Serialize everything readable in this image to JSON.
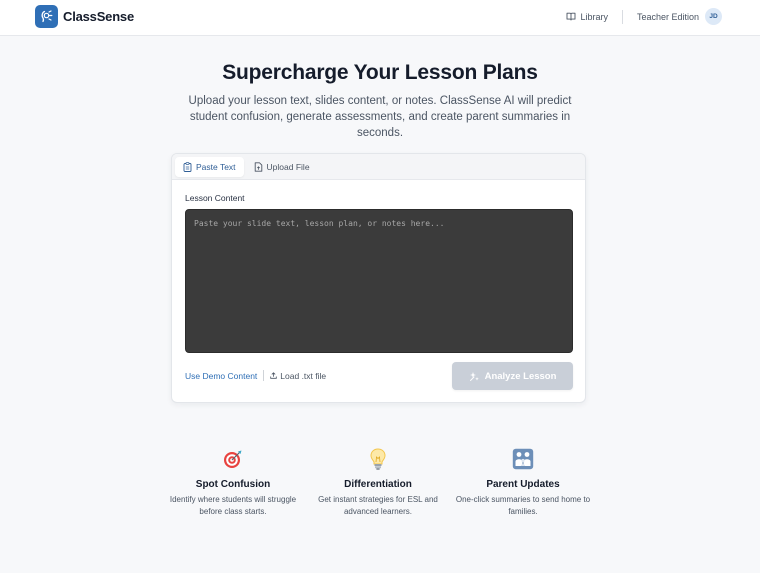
{
  "header": {
    "brand_name": "ClassSense",
    "library_label": "Library",
    "edition_label": "Teacher Edition",
    "avatar_initials": "JD"
  },
  "hero": {
    "title": "Supercharge Your Lesson Plans",
    "subtitle": "Upload your lesson text, slides content, or notes. ClassSense AI will predict student confusion, generate assessments, and create parent summaries in seconds."
  },
  "card": {
    "tabs": [
      {
        "label": "Paste Text",
        "active": true
      },
      {
        "label": "Upload File",
        "active": false
      }
    ],
    "field_label": "Lesson Content",
    "textarea_value": "",
    "textarea_placeholder": "Paste your slide text, lesson plan, or notes here...",
    "demo_link": "Use Demo Content",
    "load_link": "Load .txt file",
    "analyze_button": "Analyze Lesson"
  },
  "features": [
    {
      "icon": "target-icon",
      "title": "Spot Confusion",
      "desc": "Identify where students will struggle before class starts."
    },
    {
      "icon": "lightbulb-icon",
      "title": "Differentiation",
      "desc": "Get instant strategies for ESL and advanced learners."
    },
    {
      "icon": "family-icon",
      "title": "Parent Updates",
      "desc": "One-click summaries to send home to families."
    }
  ],
  "colors": {
    "accent": "#2f6fb6",
    "background": "#f7f8fa",
    "textarea_bg": "#3b3b3b",
    "button_disabled": "#c9cfd8"
  }
}
